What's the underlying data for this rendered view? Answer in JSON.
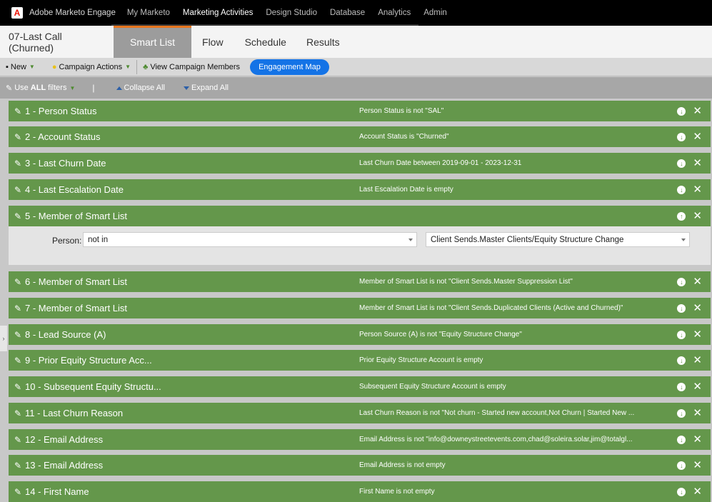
{
  "nav": {
    "brand": "Adobe Marketo Engage",
    "links": [
      "My Marketo",
      "Marketing Activities",
      "Design Studio",
      "Database",
      "Analytics",
      "Admin"
    ]
  },
  "tabs": {
    "program_title": "07-Last Call (Churned)",
    "items": [
      "Smart List",
      "Flow",
      "Schedule",
      "Results"
    ],
    "active": "Smart List"
  },
  "toolbar": {
    "new_label": "New",
    "campaign_actions_label": "Campaign Actions",
    "view_members_label": "View Campaign Members",
    "engagement_map_label": "Engagement Map"
  },
  "filterbar": {
    "use_prefix": "Use",
    "use_bold": "ALL",
    "use_suffix": "filters",
    "separator": "|",
    "collapse_label": "Collapse All",
    "expand_label": "Expand All"
  },
  "filters": [
    {
      "title": "1 - Person Status",
      "desc": "Person Status is not \"SAL\""
    },
    {
      "title": "2 - Account Status",
      "desc": "Account Status is \"Churned\""
    },
    {
      "title": "3 - Last Churn Date",
      "desc": "Last Churn Date between 2019-09-01 - 2023-12-31"
    },
    {
      "title": "4 - Last Escalation Date",
      "desc": "Last Escalation Date is empty"
    },
    {
      "title": "5 - Member of Smart List",
      "desc": ""
    },
    {
      "title": "6 - Member of Smart List",
      "desc": "Member of Smart List is not \"Client Sends.Master Suppression List\""
    },
    {
      "title": "7 - Member of Smart List",
      "desc": "Member of Smart List is not \"Client Sends.Duplicated Clients (Active and Churned)\""
    },
    {
      "title": "8 - Lead Source (A)",
      "desc": "Person Source (A) is not \"Equity Structure Change\""
    },
    {
      "title": "9 - Prior Equity Structure Acc...",
      "desc": "Prior Equity Structure Account is empty"
    },
    {
      "title": "10 - Subsequent Equity Structu...",
      "desc": "Subsequent Equity Structure Account is empty"
    },
    {
      "title": "11 - Last Churn Reason",
      "desc": "Last Churn Reason is not \"Not churn - Started new account,Not Churn | Started New ..."
    },
    {
      "title": "12 - Email Address",
      "desc": "Email Address is not \"info@downeystreetevents.com,chad@soleira.solar,jim@totalgl..."
    },
    {
      "title": "13 - Email Address",
      "desc": "Email Address is not empty"
    },
    {
      "title": "14 - First Name",
      "desc": "First Name is not empty"
    }
  ],
  "expanded_filter": {
    "label": "Person:",
    "operator": "not in",
    "value": "Client Sends.Master Clients/Equity Structure Change"
  },
  "icons": {
    "wrench": "wrench-icon",
    "move_down": "arrow-down-circle-icon",
    "move_up": "arrow-up-circle-icon",
    "remove": "close-icon"
  },
  "colors": {
    "filter_green": "#64974b",
    "accent_blue": "#1473e6",
    "tab_accent": "#e8761e"
  }
}
